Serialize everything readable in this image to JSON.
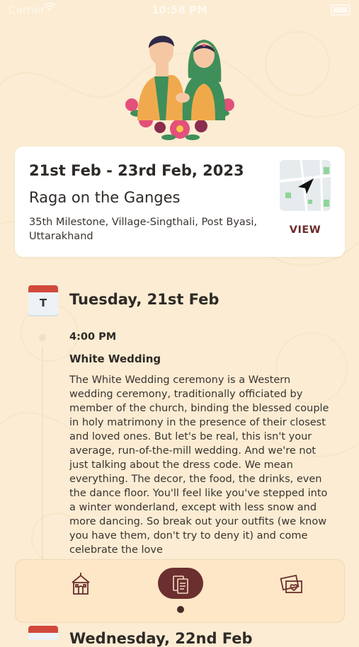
{
  "status_bar": {
    "carrier": "Carrier",
    "time": "10:58 PM"
  },
  "event": {
    "date_range": "21st Feb - 23rd Feb, 2023",
    "name": "Raga on the Ganges",
    "address": "35th Milestone, Village-Singthali, Post Byasi, Uttarakhand",
    "view_label": "VIEW"
  },
  "day": {
    "letter": "T",
    "title": "Tuesday, 21st Feb"
  },
  "schedule_item": {
    "time": "4:00 PM",
    "title": "White Wedding",
    "description": "The White Wedding ceremony is a Western wedding ceremony, traditionally officiated by member of the church, binding the blessed couple in holy matrimony in the presence of their closest and loved ones. But let's be real, this isn't your average, run-of-the-mill wedding. And we're not just talking about the dress code. We mean everything. The decor, the food, the drinks, even the dance floor. You'll feel like you've stepped into a winter wonderland, except with less snow and more dancing. So break out your outfits (we know you have them, don't try to deny it) and come celebrate the love"
  },
  "next_day": {
    "title": "Wednesday, 22nd Feb"
  },
  "nav": {
    "items": [
      "home",
      "itinerary",
      "gallery"
    ],
    "active": "itinerary"
  },
  "colors": {
    "background": "#fbecd3",
    "card": "#ffffff",
    "accent": "#6b2f2f",
    "calendar_red": "#d1493b"
  }
}
